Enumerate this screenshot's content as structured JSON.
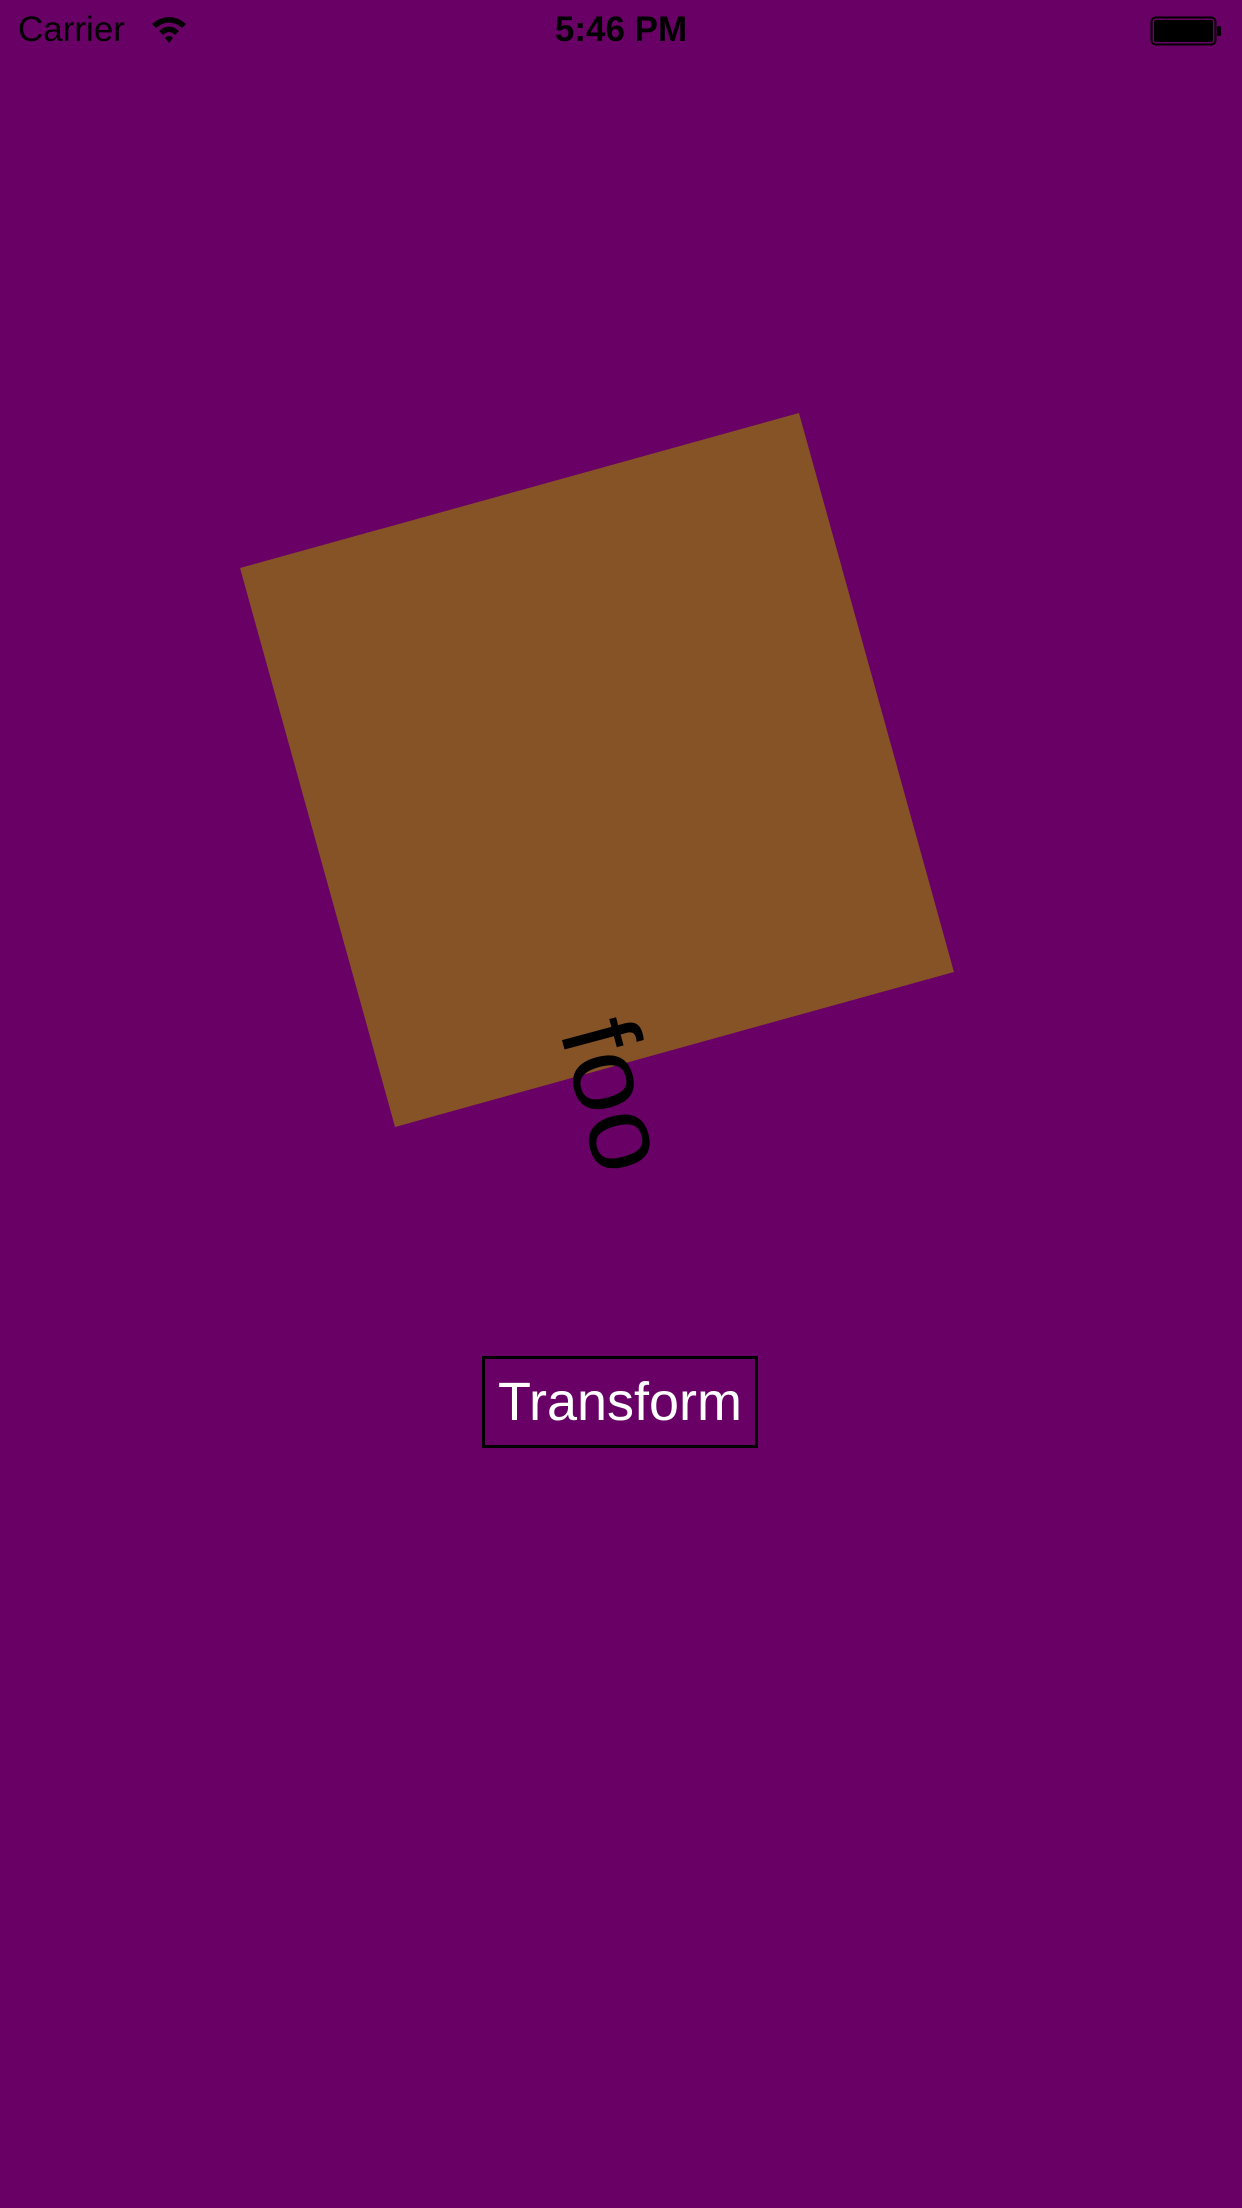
{
  "colors": {
    "background": "#690066",
    "square": "#865326",
    "status_text": "#000000",
    "button_text": "#ffffff",
    "button_border": "#000000"
  },
  "status_bar": {
    "carrier": "Carrier",
    "time": "5:46 PM",
    "wifi_icon": "wifi-icon",
    "battery_icon": "battery-icon"
  },
  "canvas": {
    "label": "foo"
  },
  "button": {
    "label": "Transform"
  }
}
